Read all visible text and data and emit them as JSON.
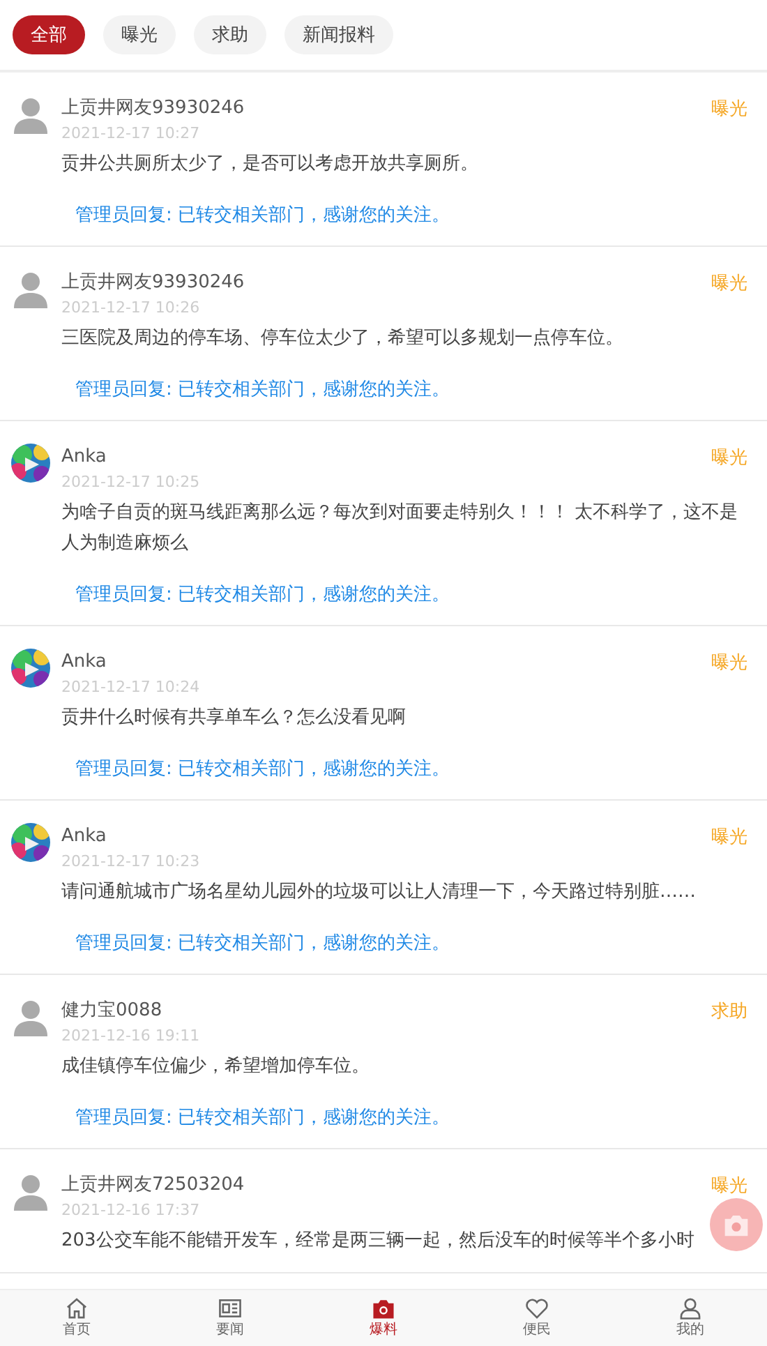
{
  "filters": [
    {
      "label": "全部",
      "selected": true
    },
    {
      "label": "曝光",
      "selected": false
    },
    {
      "label": "求助",
      "selected": false
    },
    {
      "label": "新闻报料",
      "selected": false
    }
  ],
  "posts": [
    {
      "kind": "default",
      "name": "上贡井网友93930246",
      "time": "2021-12-17 10:27",
      "category": "曝光",
      "content": "贡井公共厕所太少了，是否可以考虑开放共享厕所。",
      "reply": "管理员回复: 已转交相关部门，感谢您的关注。"
    },
    {
      "kind": "default",
      "name": "上贡井网友93930246",
      "time": "2021-12-17 10:26",
      "category": "曝光",
      "content": "三医院及周边的停车场、停车位太少了，希望可以多规划一点停车位。",
      "reply": "管理员回复: 已转交相关部门，感谢您的关注。"
    },
    {
      "name": "Anka",
      "time": "2021-12-17 10:25",
      "category": "曝光",
      "content": "为啥子自贡的斑马线距离那么远？每次到对面要走特别久！！！ 太不科学了，这不是人为制造麻烦么",
      "reply": "管理员回复: 已转交相关部门，感谢您的关注。"
    },
    {
      "name": "Anka",
      "time": "2021-12-17 10:24",
      "category": "曝光",
      "content": "贡井什么时候有共享单车么？怎么没看见啊",
      "reply": "管理员回复: 已转交相关部门，感谢您的关注。"
    },
    {
      "name": "Anka",
      "time": "2021-12-17 10:23",
      "category": "曝光",
      "content": "请问通航城市广场名星幼儿园外的垃圾可以让人清理一下，今天路过特别脏……",
      "reply": "管理员回复: 已转交相关部门，感谢您的关注。"
    },
    {
      "kind": "default",
      "name": "健力宝0088",
      "time": "2021-12-16 19:11",
      "category": "求助",
      "content": "成佳镇停车位偏少，希望增加停车位。",
      "reply": "管理员回复: 已转交相关部门，感谢您的关注。"
    },
    {
      "kind": "default",
      "name": "上贡井网友72503204",
      "time": "2021-12-16 17:37",
      "category": "曝光",
      "content": "203公交车能不能错开发车，经常是两三辆一起，然后没车的时候等半个多小时"
    }
  ],
  "nav": [
    {
      "kind": "home",
      "label": "首页",
      "selected": false
    },
    {
      "kind": "news",
      "label": "要闻",
      "selected": false
    },
    {
      "kind": "camera",
      "label": "爆料",
      "selected": true
    },
    {
      "kind": "heart",
      "label": "便民",
      "selected": false
    },
    {
      "kind": "person",
      "label": "我的",
      "selected": false
    }
  ]
}
